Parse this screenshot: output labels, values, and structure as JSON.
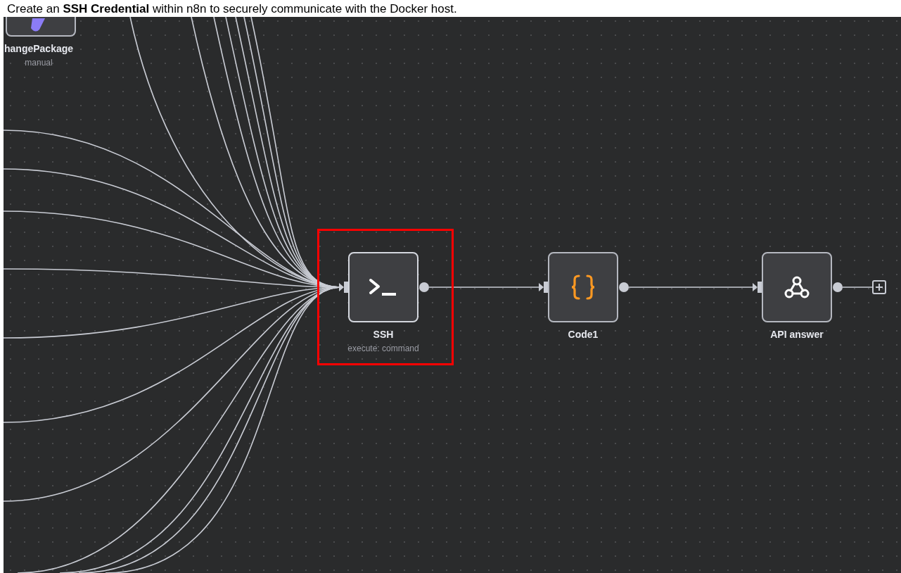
{
  "instruction": "Create an **SSH Credential** within n8n to securely communicate with the Docker host.",
  "nodes": [
    {
      "kind": "package",
      "name": "hangePackage",
      "subtitle": "manual",
      "highlighted": false
    },
    {
      "kind": "terminal",
      "name": "SSH",
      "subtitle": "execute: command",
      "highlighted": true
    },
    {
      "kind": "code",
      "name": "Code1",
      "highlighted": false
    },
    {
      "kind": "webhook",
      "name": "API answer",
      "highlighted": false
    }
  ]
}
